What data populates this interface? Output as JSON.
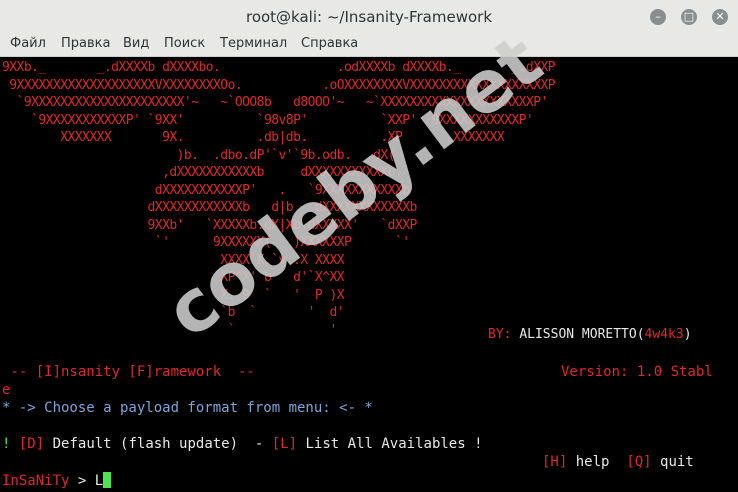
{
  "window": {
    "title": "root@kali: ~/Insanity-Framework"
  },
  "menu": [
    "Файл",
    "Правка",
    "Вид",
    "Поиск",
    "Терминал",
    "Справка"
  ],
  "art_lines": [
    "9XXb._       _.dXXXXb dXXXXbo.                .odXXXXb dXXXXb._       _.dXXP",
    " 9XXXXXXXXXXXXXXXXXXXVXXXXXXXXOo.           .oOXXXXXXXXVXXXXXXXXXXXXXXXXXXXP",
    "  `9XXXXXXXXXXXXXXXXXXXXX'~   ~`OOO8b   d8OOO'~   ~`XXXXXXXXXXXXXXXXXXXXXP'",
    "    `9XXXXXXXXXXXP' `9XX'          `98v8P'          `XXP' `9XXXXXXXXXXXP'",
    "        XXXXXXX       9X.          .db|db.          .XP       XXXXXXX",
    "                        )b.  .dbo.dP'`v'`9b.odb.  .dX(",
    "                      ,dXXXXXXXXXXXb     dXXXXXXXXXXXb.",
    "                     dXXXXXXXXXXXP'   .   `9XXXXXXXXXXXb",
    "                    dXXXXXXXXXXXXb   d|b   dXXXXXXXXXXXXb",
    "                    9XXb'   `XXXXXb.dX|Xb.dXXXXX'   `dXXP",
    "                     `'      9XXXXXX(   )XXXXXXP      `'",
    "                              XXXX X.`v'.X XXXX",
    "                              XP^X'`b   d'`X^XX",
    "                              X. 9  `   '  P )X",
    "                              `b  `       '  d'",
    "                               `             '"
  ],
  "watermark": "codeby.net",
  "author": {
    "prefix": "BY:",
    "name": "ALISSON MORETTO",
    "open": "(",
    "handle": "4w4k3",
    "close": ")"
  },
  "header": {
    "left": " -- [I]nsanity [F]ramework  --",
    "version": "Version: 1.0 Stabl",
    "version_wrap": "e"
  },
  "choose_text": "* -> Choose a payload format from menu: <- *",
  "options": {
    "bang": "!",
    "d_key": "[D]",
    "d_label": " Default (flash update)",
    "sep": "  -",
    "l_key": "[L]",
    "l_label": " List All Availables",
    "end": " !"
  },
  "help": {
    "h_key": "[H]",
    "h_label": " help",
    "q_key": "[Q]",
    "q_label": " quit"
  },
  "prompt": {
    "label": "InSaNiTy",
    "arrow": " > ",
    "value": "L"
  }
}
